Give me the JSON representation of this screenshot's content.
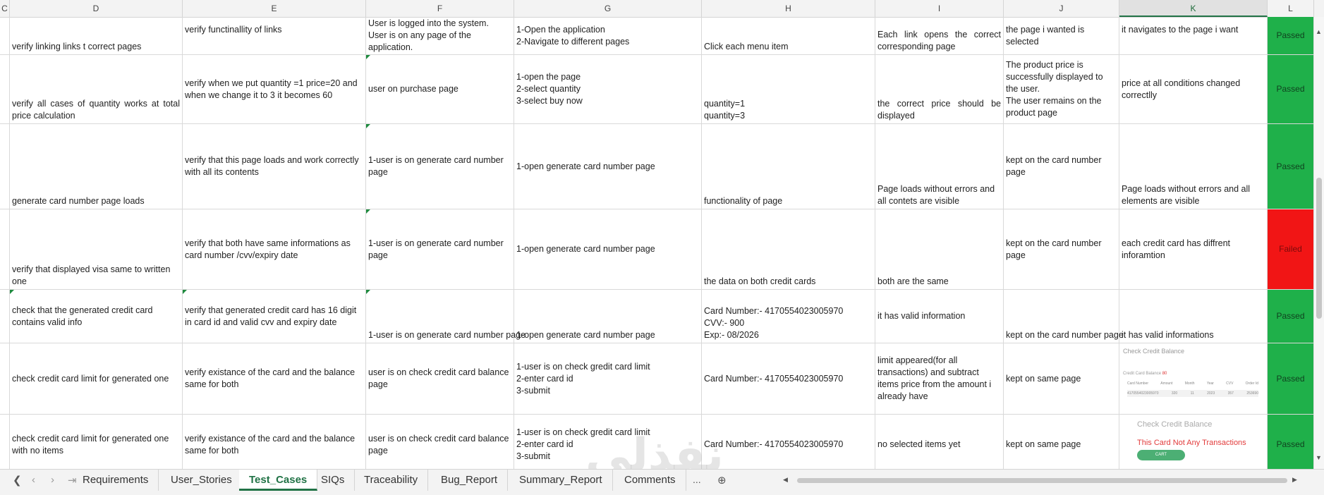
{
  "columns": [
    "C",
    "D",
    "E",
    "F",
    "G",
    "H",
    "I",
    "J",
    "K",
    "L"
  ],
  "selected_column": "K",
  "rows": [
    {
      "d": "verify linking links t correct pages",
      "e": "verify functinallity of links",
      "f": "User is logged into the system.\nUser is on any page of the application.",
      "g": "1-Open the application\n2-Navigate to different pages",
      "h": "Click each menu item",
      "i": "Each link opens the correct corresponding page",
      "j": "the page i wanted is selected",
      "k": "it navigates to the page i want",
      "status": "Passed"
    },
    {
      "d": "verify all cases of quantity works at total price calculation",
      "e": "verify when we put quantity =1 price=20 and when we change it to 3 it becomes 60",
      "f": "user on purchase page",
      "g": "1-open the page\n2-select quantity\n3-select buy now",
      "h": "quantity=1\nquantity=3",
      "i": "the correct price should be displayed",
      "j": "The product price is successfully displayed to the user.\nThe user remains on the product page",
      "k": "price at all conditions changed correctlly",
      "status": "Passed"
    },
    {
      "d": "generate card number page loads",
      "e": "verify that this page loads and work correctly with all its contents",
      "f": "1-user is on generate card number page",
      "g": "1-open generate card number page",
      "h": "functionality of page",
      "i": "Page loads without errors and all contets are visible",
      "j": "kept on the card number page",
      "k": "Page loads without errors and all elements are visible",
      "status": "Passed"
    },
    {
      "d": "verify that displayed visa same to written one",
      "e": "verify that both have same informations as card number /cvv/expiry date",
      "f": "1-user is on generate card number page",
      "g": "1-open generate card number page",
      "h": "the data on both credit cards",
      "i": "both are the same",
      "j": "kept on the card number page",
      "k": "each credit card has diffrent inforamtion",
      "status": "Failed"
    },
    {
      "d": "check that the generated credit card contains valid info",
      "e": "verify that generated credit card has 16 digit in card id and valid cvv and expiry date",
      "f": "1-user is on generate card number page",
      "g": "1-open generate card number page",
      "h": "Card Number:- 4170554023005970\nCVV:- 900\nExp:- 08/2026",
      "i": "it has valid information",
      "j": "kept on the card number page",
      "k": "it has valid informations",
      "status": "Passed"
    },
    {
      "d": "check credit card limit for generated one",
      "e": "verify existance of the card and the balance same for both",
      "f": "user is on check credit card balance page",
      "g": "1-user is on check gredit card limit\n2-enter card id\n3-submit",
      "h": "Card Number:- 4170554023005970",
      "i": "limit appeared(for all transactions) and subtract items price from the amount i already have",
      "j": "kept on same page",
      "k": "",
      "status": "Passed"
    },
    {
      "d": "check credit card limit for generated one with no items",
      "e": "verify existance of the card and the balance same for both",
      "f": "user is on check credit card balance page",
      "g": "1-user is on check gredit card limit\n2-enter card id\n3-submit",
      "h": "Card Number:- 4170554023005970",
      "i": "no selected items yet",
      "j": "kept on same page",
      "k": "",
      "status": "Passed"
    }
  ],
  "thumb1": {
    "title": "Check Credit Balance",
    "balance_label": "Credit Card Balance",
    "balance_value": "80",
    "headers": [
      "Card Number",
      "Amount",
      "Month",
      "Year",
      "CVV",
      "Order Id"
    ],
    "row": [
      "4170554023005970",
      "320",
      "11",
      "2023",
      "357",
      "253690"
    ]
  },
  "thumb2": {
    "title": "Check Credit Balance",
    "message": "This Card Not Any Transactions",
    "button": "CART"
  },
  "sheet_tabs": [
    "Requirements",
    "User_Stories",
    "Test_Cases",
    "SIQs",
    "Traceability",
    "Bug_Report",
    "Summary_Report",
    "Comments"
  ],
  "active_tab": "Test_Cases",
  "more_tabs": "...",
  "colors": {
    "passed": "#1fb04a",
    "failed": "#f11515",
    "accent": "#217346"
  }
}
